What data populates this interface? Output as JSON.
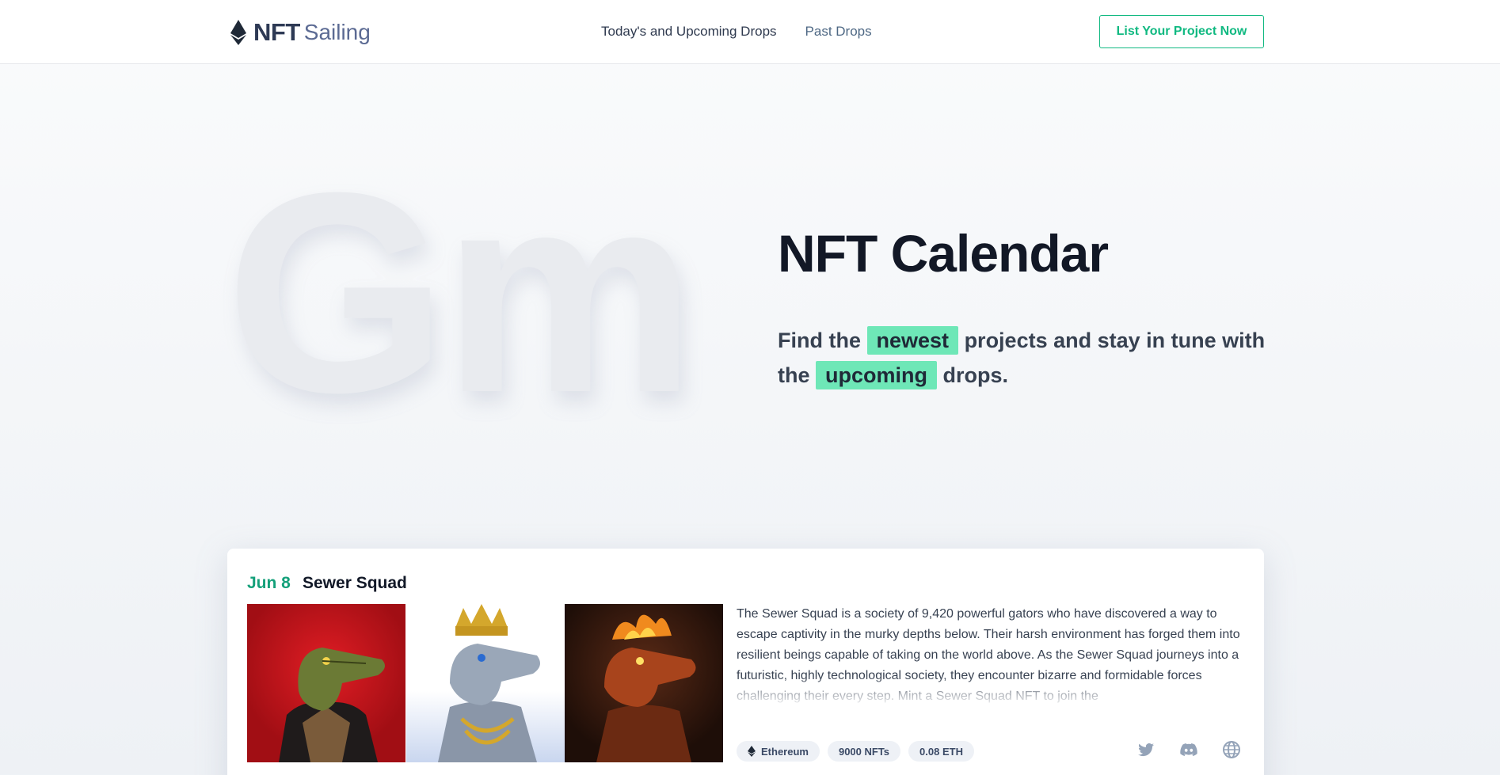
{
  "brand": {
    "name_bold": "NFT",
    "name_light": "Sailing"
  },
  "nav": {
    "links": [
      {
        "label": "Today's and Upcoming Drops"
      },
      {
        "label": "Past Drops"
      }
    ],
    "cta_label": "List Your Project Now"
  },
  "hero": {
    "background_word": "Gm",
    "title": "NFT Calendar",
    "subtitle": {
      "part1": "Find the",
      "highlight1": "newest",
      "part2": "projects and stay in tune with the",
      "highlight2": "upcoming",
      "part3": "drops."
    }
  },
  "project": {
    "date": "Jun 8",
    "title": "Sewer Squad",
    "description": "The Sewer Squad is a society of 9,420 powerful gators who have discovered a way to escape captivity in the murky depths below. Their harsh environment has forged them into resilient beings capable of taking on the world above. As the Sewer Squad journeys into a futuristic, highly technological society, they encounter bizarre and formidable forces challenging their every step. Mint a Sewer Squad NFT to join the",
    "tags": {
      "chain": "Ethereum",
      "supply": "9000 NFTs",
      "price": "0.08 ETH"
    },
    "icons": [
      "ethereum-icon",
      "twitter-icon",
      "discord-icon",
      "globe-icon"
    ]
  },
  "colors": {
    "accent": "#10b981",
    "highlight": "#6ee7b7",
    "date": "#14a07a"
  }
}
